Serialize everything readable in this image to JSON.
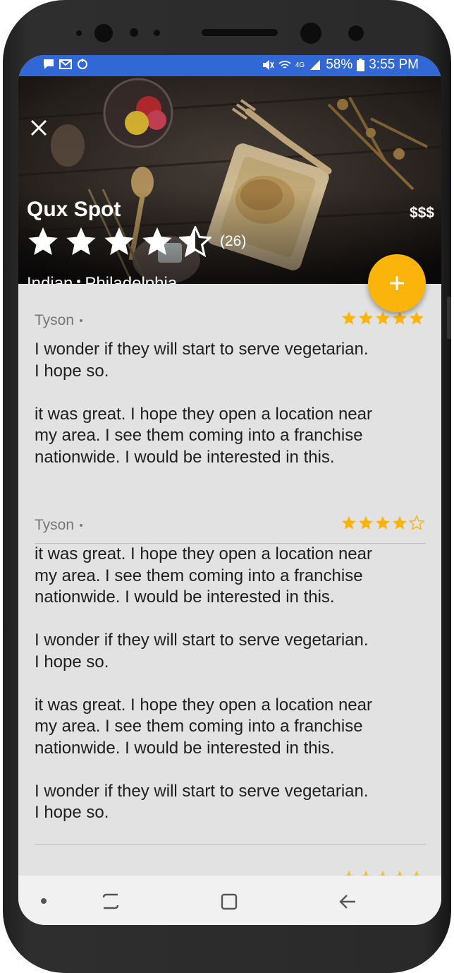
{
  "status_bar": {
    "battery": "58%",
    "time": "3:55 PM",
    "network": "4G"
  },
  "restaurant": {
    "name": "Qux Spot",
    "price": "$$$",
    "rating": 4.5,
    "rating_count": "(26)",
    "category": "Indian",
    "city": "Philadelphia"
  },
  "colors": {
    "accent": "#fbb40c",
    "status_bar": "#3267d6",
    "star": "#fbb40c"
  },
  "reviews": [
    {
      "author": "Tyson",
      "rating": 5,
      "text": "I wonder if they will start to serve vegetarian.\nI hope so.\n\nit was great. I hope they open a location near\nmy area. I see them coming into a franchise\nnationwide. I would be interested in this."
    },
    {
      "author": "Tyson",
      "rating": 4,
      "text": "it was great. I hope they open a location near\nmy area. I see them coming into a franchise\nnationwide. I would be interested in this.\n\nI wonder if they will start to serve vegetarian.\nI hope so.\n\nit was great. I hope they open a location near\nmy area. I see them coming into a franchise\nnationwide. I would be interested in this.\n\nI wonder if they will start to serve vegetarian.\nI hope so."
    }
  ],
  "icons": {
    "close": "close-icon",
    "add": "plus-icon",
    "nav_back": "back-icon",
    "nav_home": "home-icon",
    "nav_recents": "recents-icon"
  }
}
